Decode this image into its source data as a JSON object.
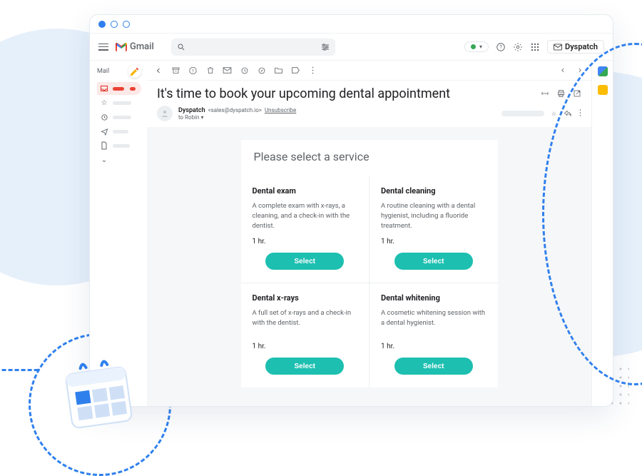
{
  "app": {
    "name": "Gmail",
    "brand_chip": "Dyspatch"
  },
  "leftnav": {
    "label_mail": "Mail"
  },
  "email": {
    "subject": "It's time to book your upcoming dental appointment",
    "sender_name": "Dyspatch",
    "sender_email": "<sales@dyspatch.io>",
    "unsubscribe": "Unsubscribe",
    "to_line": "to Robin",
    "panel_title": "Please select a service",
    "services": [
      {
        "title": "Dental exam",
        "desc": "A complete exam with x-rays, a cleaning, and a check-in with the dentist.",
        "duration": "1 hr.",
        "cta": "Select"
      },
      {
        "title": "Dental cleaning",
        "desc": "A routine cleaning with a dental hygienist, including a fluoride treatment.",
        "duration": "1 hr.",
        "cta": "Select"
      },
      {
        "title": "Dental x-rays",
        "desc": "A full set of x-rays and a check-in with the dentist.",
        "duration": "1 hr.",
        "cta": "Select"
      },
      {
        "title": "Dental whitening",
        "desc": "A cosmetic whitening session with a dental hygienist.",
        "duration": "1 hr.",
        "cta": "Select"
      }
    ]
  },
  "colors": {
    "accent": "#2F80ED",
    "cta": "#1dbfb0"
  }
}
